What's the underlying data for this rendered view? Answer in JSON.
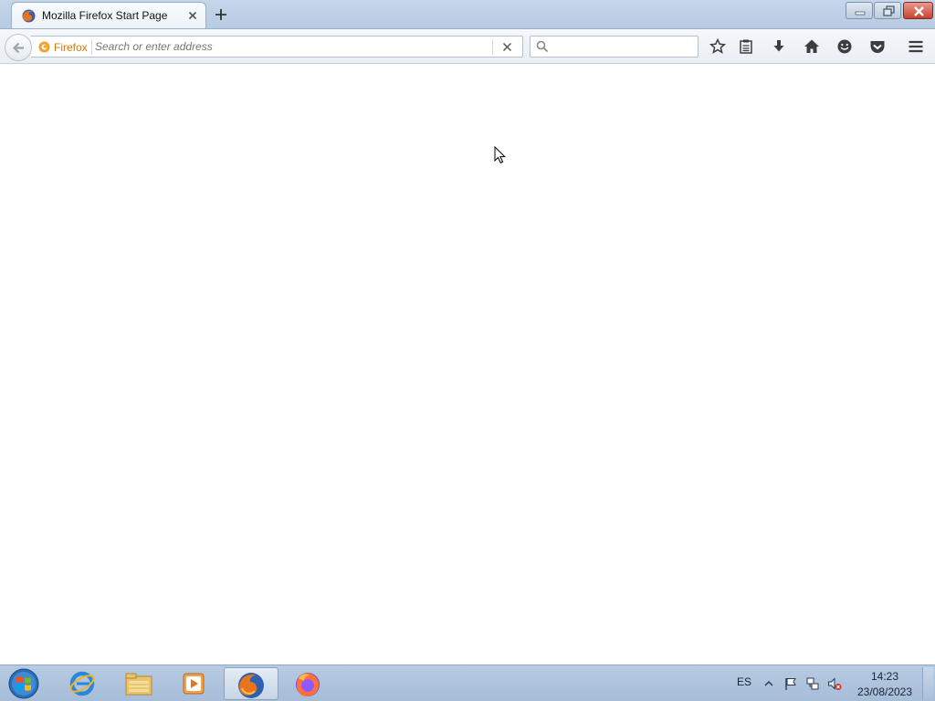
{
  "window": {
    "tab_title": "Mozilla Firefox Start Page"
  },
  "navbar": {
    "identity_label": "Firefox",
    "url_placeholder": "Search or enter address",
    "url_value": "",
    "search_placeholder": "",
    "icons": [
      "back-icon",
      "bookmark-star-icon",
      "reading-list-icon",
      "download-icon",
      "home-icon",
      "hello-chat-icon",
      "pocket-icon",
      "menu-icon"
    ]
  },
  "taskbar": {
    "apps": [
      "internet-explorer-icon",
      "file-explorer-icon",
      "media-player-icon",
      "firefox-icon",
      "firefox-new-icon"
    ],
    "language": "ES",
    "time": "14:23",
    "date": "23/08/2023"
  },
  "colors": {
    "titlebar": "#c5d6ea",
    "identity_text": "#d07a12",
    "close_button": "#c74230"
  }
}
